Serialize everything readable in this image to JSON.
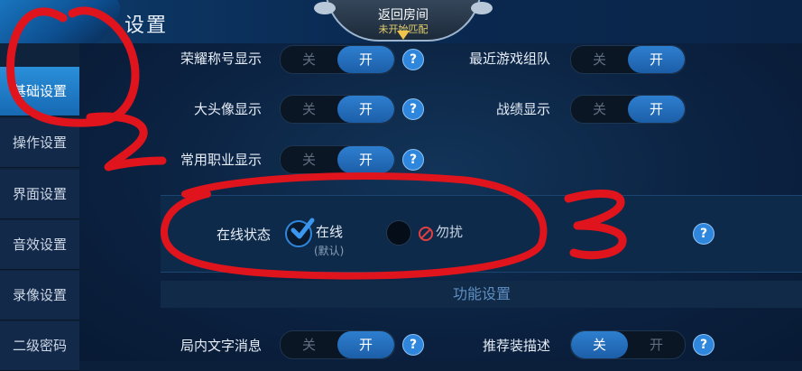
{
  "header": {
    "title": "设置",
    "room_button": {
      "label": "返回房间",
      "sub_label": "未开始匹配"
    }
  },
  "sidebar": {
    "items": [
      {
        "label": "基础设置",
        "active": true
      },
      {
        "label": "操作设置"
      },
      {
        "label": "界面设置"
      },
      {
        "label": "音效设置"
      },
      {
        "label": "录像设置"
      },
      {
        "label": "二级密码"
      }
    ]
  },
  "toggle_text": {
    "off": "关",
    "on": "开"
  },
  "settings": {
    "honor_title": {
      "label": "荣耀称号显示",
      "value": "开"
    },
    "recent_team": {
      "label": "最近游戏组队",
      "value": "开"
    },
    "avatar_display": {
      "label": "大头像显示",
      "value": "开"
    },
    "record_display": {
      "label": "战绩显示",
      "value": "开"
    },
    "common_job": {
      "label": "常用职业显示",
      "value": "开"
    },
    "online_status": {
      "label": "在线状态",
      "options": [
        {
          "label": "在线",
          "note": "(默认)",
          "selected": true
        },
        {
          "label": "勿扰",
          "selected": false
        }
      ]
    },
    "in_game_text": {
      "label": "局内文字消息",
      "value": "开"
    },
    "recommend_equip": {
      "label": "推荐装描述",
      "value": "关"
    }
  },
  "section": {
    "function_settings": "功能设置"
  },
  "annotations": {
    "mark_2": "2",
    "mark_3": "3"
  },
  "colors": {
    "accent": "#2f86dd",
    "annotation": "#e0141c"
  }
}
